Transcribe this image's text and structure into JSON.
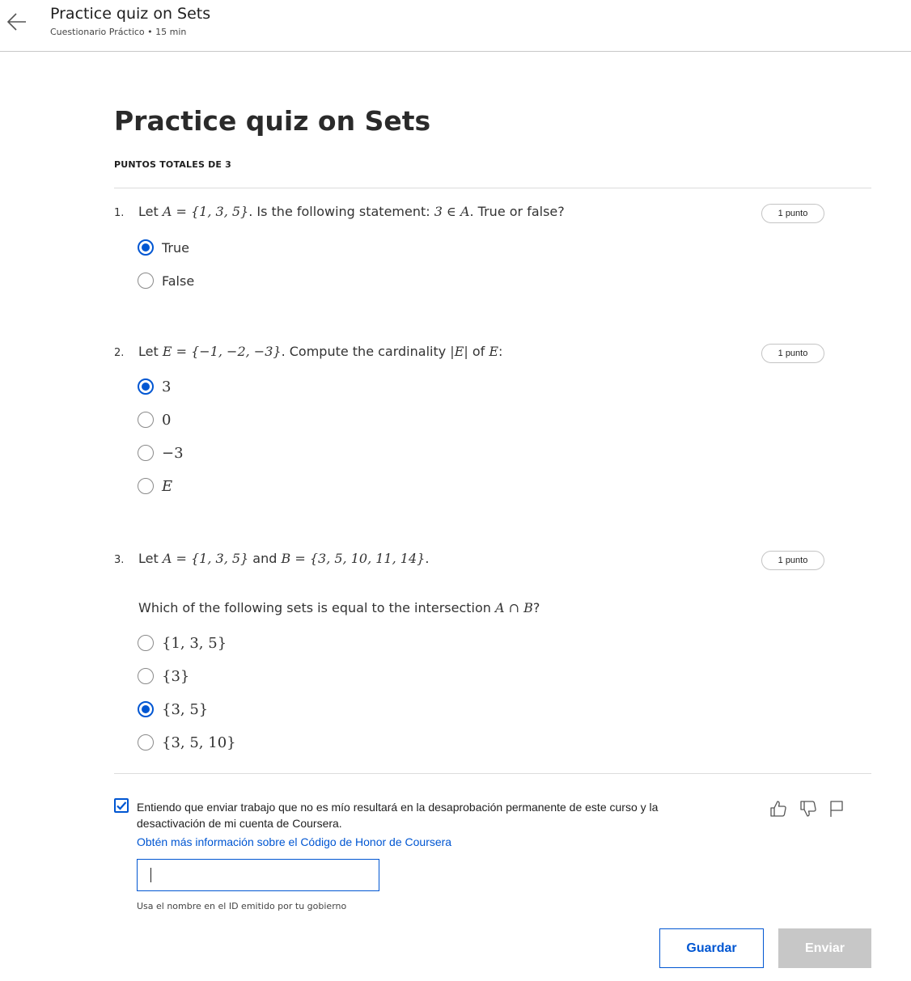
{
  "header": {
    "title": "Practice quiz on Sets",
    "subtitle": "Cuestionario Práctico • 15 min"
  },
  "main": {
    "title": "Practice quiz on Sets",
    "total_points": "PUNTOS TOTALES DE 3"
  },
  "questions": [
    {
      "number": "1.",
      "points": "1 punto",
      "text_parts": [
        "Let ",
        "A = {1, 3, 5}",
        ". Is the following statement: ",
        "3 ∈ A",
        ". True or false?"
      ],
      "options": [
        {
          "label": "True",
          "selected": true
        },
        {
          "label": "False",
          "selected": false
        }
      ]
    },
    {
      "number": "2.",
      "points": "1 punto",
      "text_parts": [
        "Let ",
        "E = {−1, −2, −3}",
        ". Compute the cardinality ",
        "|E|",
        " of ",
        "E",
        ":"
      ],
      "options": [
        {
          "label": "3",
          "selected": true
        },
        {
          "label": "0",
          "selected": false
        },
        {
          "label": "−3",
          "selected": false
        },
        {
          "label": "E",
          "selected": false
        }
      ]
    },
    {
      "number": "3.",
      "points": "1 punto",
      "text_parts": [
        "Let ",
        "A = {1, 3, 5}",
        " and ",
        "B = {3, 5, 10, 11, 14}",
        "."
      ],
      "subtext_parts": [
        "Which of the following sets is equal to the intersection ",
        "A ∩ B",
        "?"
      ],
      "options": [
        {
          "label": "{1, 3, 5}",
          "selected": false
        },
        {
          "label": "{3}",
          "selected": false
        },
        {
          "label": "{3, 5}",
          "selected": true
        },
        {
          "label": "{3, 5, 10}",
          "selected": false
        }
      ]
    }
  ],
  "honor": {
    "checked": true,
    "text": "Entiendo que enviar trabajo que no es mío resultará en la desaprobación permanente de este curso y la desactivación de mi cuenta de Coursera.",
    "link": "Obtén más información sobre el Código de Honor de Coursera",
    "input_value": "",
    "helper": "Usa el nombre en el ID emitido por tu gobierno"
  },
  "feedback_icons": [
    "thumbs-up-icon",
    "thumbs-down-icon",
    "flag-icon"
  ],
  "buttons": {
    "save": "Guardar",
    "submit": "Enviar"
  },
  "colors": {
    "accent": "#0056d2",
    "disabled": "#c7c7c7"
  }
}
